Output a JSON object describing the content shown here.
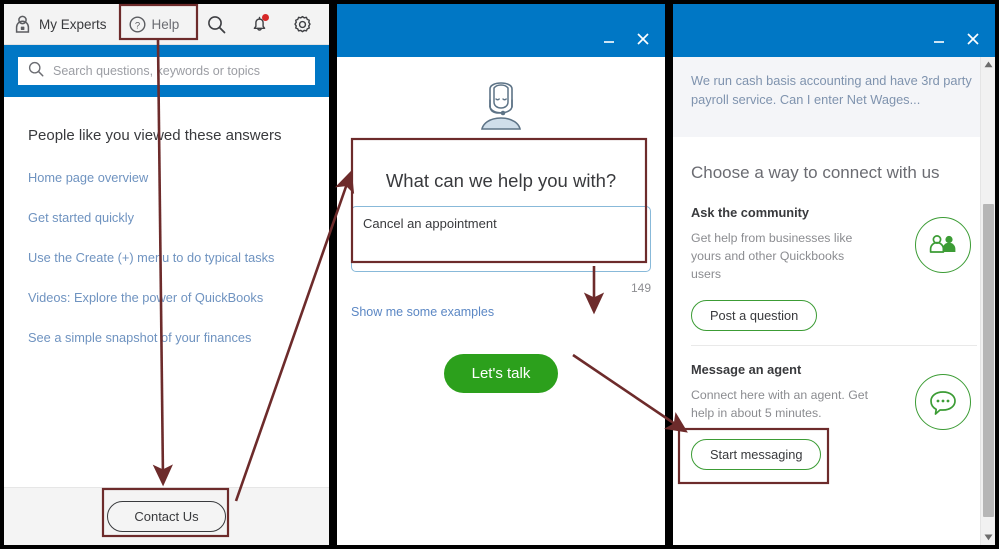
{
  "colors": {
    "brand_blue": "#0077c5",
    "green": "#2ca01c",
    "green_outline": "#3c9c35",
    "annotation": "#6d2b2b",
    "link_blue": "#6f93c0",
    "notification_red": "#d62727"
  },
  "left_panel": {
    "toolbar": {
      "my_experts_label": "My Experts",
      "help_label": "Help",
      "icons": [
        "search-icon",
        "notifications-bell-icon",
        "settings-gear-icon"
      ]
    },
    "search": {
      "placeholder": "Search questions, keywords or topics",
      "value": ""
    },
    "heading": "People like you viewed these answers",
    "links": [
      "Home page overview",
      "Get started quickly",
      "Use the Create (+) menu to do typical tasks",
      "Videos: Explore the power of QuickBooks",
      "See a simple snapshot of your finances"
    ],
    "footer": {
      "contact_label": "Contact Us"
    }
  },
  "middle_panel": {
    "titlebar": {
      "minimize": "—",
      "close": "✕"
    },
    "avatar": "support-agent-avatar",
    "question": "What can we help you with?",
    "textarea": {
      "value": "Cancel an appointment",
      "placeholder": ""
    },
    "counter": "149",
    "examples_link": "Show me some examples",
    "cta_label": "Let's talk"
  },
  "right_panel": {
    "titlebar": {
      "minimize": "—",
      "close": "✕"
    },
    "quote": "We run cash basis accounting and have 3rd party payroll service. Can I enter Net Wages...",
    "heading": "Choose a way to connect with us",
    "sections": [
      {
        "title": "Ask the community",
        "desc": "Get help from businesses like yours and other Quickbooks users",
        "button": "Post a question",
        "icon": "community-people-icon"
      },
      {
        "title": "Message an agent",
        "desc": "Connect here with an agent. Get help in about 5 minutes.",
        "button": "Start messaging",
        "icon": "chat-bubble-icon"
      }
    ]
  }
}
